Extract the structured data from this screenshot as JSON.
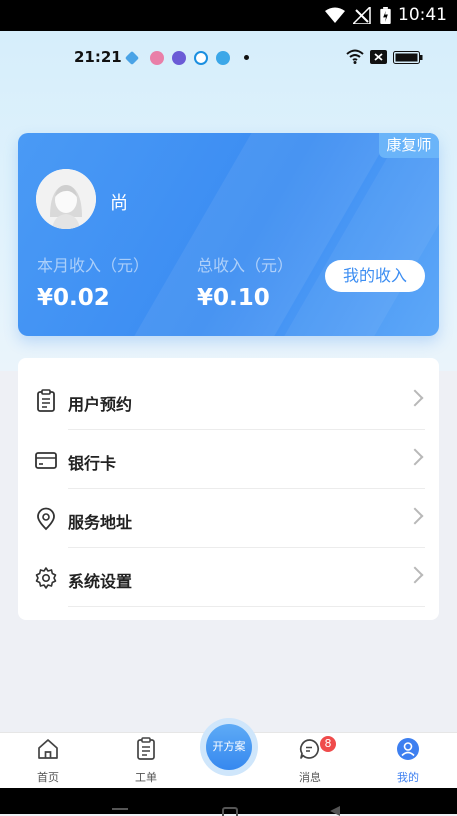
{
  "system_bar": {
    "time": "10:41"
  },
  "inner_status": {
    "time": "21:21"
  },
  "card": {
    "badge": "康复师",
    "username": "尚",
    "month_income_label": "本月收入（元）",
    "month_income_value": "¥0.02",
    "total_income_label": "总收入（元）",
    "total_income_value": "¥0.10",
    "income_button": "我的收入"
  },
  "menu": {
    "items": [
      {
        "label": "用户预约",
        "icon": "clipboard-icon"
      },
      {
        "label": "银行卡",
        "icon": "card-icon"
      },
      {
        "label": "服务地址",
        "icon": "location-icon"
      },
      {
        "label": "系统设置",
        "icon": "gear-icon"
      }
    ]
  },
  "nav": {
    "items": [
      {
        "label": "首页",
        "icon": "home-icon"
      },
      {
        "label": "工单",
        "icon": "clipboard-icon"
      },
      {
        "label": "消息",
        "icon": "chat-icon"
      },
      {
        "label": "我的",
        "icon": "user-icon"
      }
    ],
    "center_label": "开方案",
    "message_badge": "8"
  },
  "colors": {
    "accent": "#3d8ef2",
    "badge_red": "#ef4b4b"
  }
}
